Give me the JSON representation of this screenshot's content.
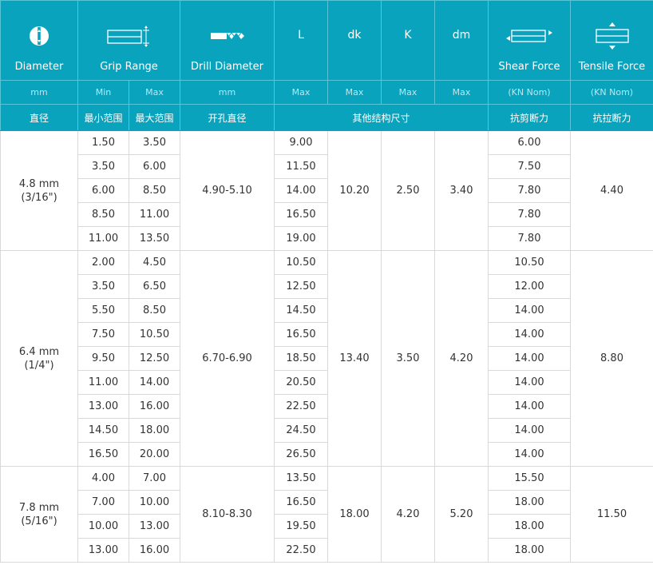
{
  "columns": {
    "diameter": {
      "label": "Diameter",
      "unit": "mm",
      "cn": "直径",
      "icon": "rivet-head-icon"
    },
    "grip_range": {
      "label": "Grip Range",
      "min_label": "Min",
      "max_label": "Max",
      "cn_min": "最小范围",
      "cn_max": "最大范围",
      "icon": "grip-range-icon"
    },
    "drill": {
      "label": "Drill Diameter",
      "unit": "mm",
      "cn": "开孔直径",
      "icon": "drill-bit-icon"
    },
    "dims": {
      "L": "L",
      "dk": "dk",
      "K": "K",
      "dm": "dm",
      "unit": "Max",
      "cn": "其他结构尺寸"
    },
    "shear": {
      "label": "Shear Force",
      "unit": "(KN Nom)",
      "cn": "抗剪断力",
      "icon": "shear-force-icon"
    },
    "tensile": {
      "label": "Tensile Force",
      "unit": "(KN Nom)",
      "cn": "抗拉断力",
      "icon": "tensile-force-icon"
    }
  },
  "colors": {
    "header_bg": "#0aa3bd",
    "header_text": "#ffffff",
    "grid": "#d9d9d9",
    "body_text": "#333333"
  },
  "groups": [
    {
      "diameter": "4.8 mm",
      "diameter_in": "(3/16\")",
      "drill": "4.90-5.10",
      "dk": "10.20",
      "K": "2.50",
      "dm": "3.40",
      "tensile": "4.40",
      "rows": [
        {
          "min": "1.50",
          "max": "3.50",
          "L": "9.00",
          "shear": "6.00"
        },
        {
          "min": "3.50",
          "max": "6.00",
          "L": "11.50",
          "shear": "7.50"
        },
        {
          "min": "6.00",
          "max": "8.50",
          "L": "14.00",
          "shear": "7.80"
        },
        {
          "min": "8.50",
          "max": "11.00",
          "L": "16.50",
          "shear": "7.80"
        },
        {
          "min": "11.00",
          "max": "13.50",
          "L": "19.00",
          "shear": "7.80"
        }
      ]
    },
    {
      "diameter": "6.4 mm",
      "diameter_in": "(1/4\")",
      "drill": "6.70-6.90",
      "dk": "13.40",
      "K": "3.50",
      "dm": "4.20",
      "tensile": "8.80",
      "rows": [
        {
          "min": "2.00",
          "max": "4.50",
          "L": "10.50",
          "shear": "10.50"
        },
        {
          "min": "3.50",
          "max": "6.50",
          "L": "12.50",
          "shear": "12.00"
        },
        {
          "min": "5.50",
          "max": "8.50",
          "L": "14.50",
          "shear": "14.00"
        },
        {
          "min": "7.50",
          "max": "10.50",
          "L": "16.50",
          "shear": "14.00"
        },
        {
          "min": "9.50",
          "max": "12.50",
          "L": "18.50",
          "shear": "14.00"
        },
        {
          "min": "11.00",
          "max": "14.00",
          "L": "20.50",
          "shear": "14.00"
        },
        {
          "min": "13.00",
          "max": "16.00",
          "L": "22.50",
          "shear": "14.00"
        },
        {
          "min": "14.50",
          "max": "18.00",
          "L": "24.50",
          "shear": "14.00"
        },
        {
          "min": "16.50",
          "max": "20.00",
          "L": "26.50",
          "shear": "14.00"
        }
      ]
    },
    {
      "diameter": "7.8 mm",
      "diameter_in": "(5/16\")",
      "drill": "8.10-8.30",
      "dk": "18.00",
      "K": "4.20",
      "dm": "5.20",
      "tensile": "11.50",
      "rows": [
        {
          "min": "4.00",
          "max": "7.00",
          "L": "13.50",
          "shear": "15.50"
        },
        {
          "min": "7.00",
          "max": "10.00",
          "L": "16.50",
          "shear": "18.00"
        },
        {
          "min": "10.00",
          "max": "13.00",
          "L": "19.50",
          "shear": "18.00"
        },
        {
          "min": "13.00",
          "max": "16.00",
          "L": "22.50",
          "shear": "18.00"
        }
      ]
    }
  ]
}
